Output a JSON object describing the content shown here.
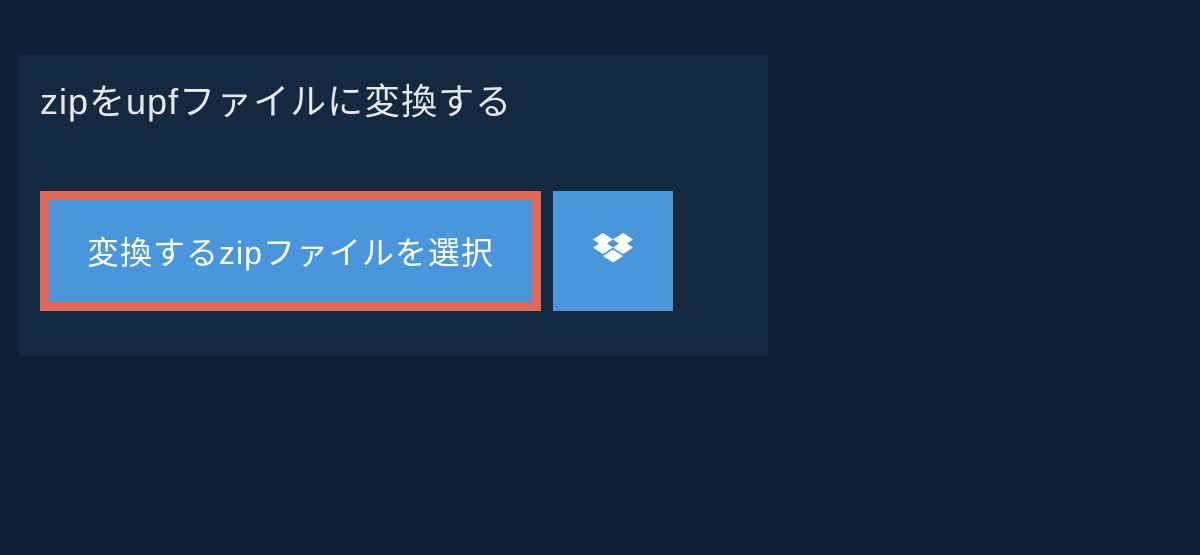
{
  "header": {
    "title": "zipをupfファイルに変換する"
  },
  "buttons": {
    "select_label": "変換するzipファイルを選択"
  },
  "colors": {
    "bg": "#0d2034",
    "panel": "#14293f",
    "button": "#4a96dd",
    "border_highlight": "#e06858"
  }
}
